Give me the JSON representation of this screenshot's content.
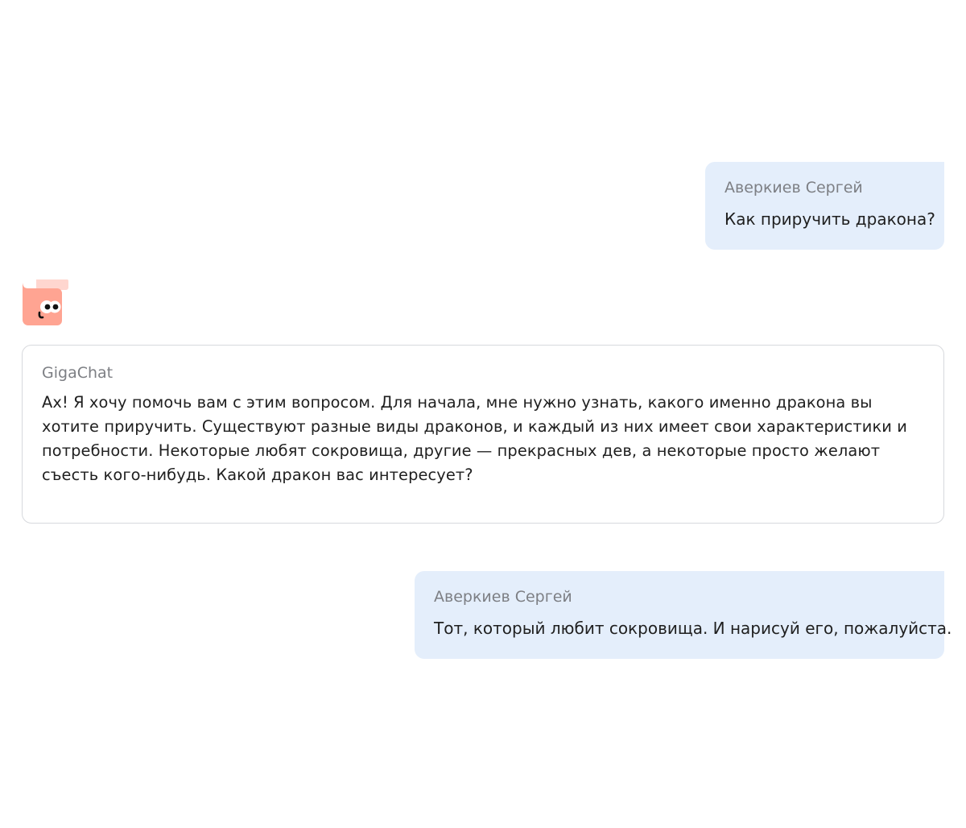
{
  "messages": [
    {
      "author": "Аверкиев Сергей",
      "text": "Как приручить дракона?"
    },
    {
      "author": "GigaChat",
      "avatar_icon": "gigachat-mascot-icon",
      "text": "Ах! Я хочу помочь вам с этим вопросом. Для начала, мне нужно узнать, какого именно дракона вы хотите приручить. Существуют разные виды драконов, и каждый из них имеет свои характеристики и потребности. Некоторые любят сокровища, другие — прекрасных дев, а некоторые просто желают съесть кого-нибудь. Какой дракон вас интересует?"
    },
    {
      "author": "Аверкиев Сергей",
      "text": "Тот, который любит сокровища. И нарисуй его, пожалуйста."
    }
  ],
  "colors": {
    "user_bubble": "#e4eefb",
    "bot_border": "#d7d9dd",
    "author_text": "#7d7f84",
    "mascot": "#ffa492",
    "mascot_light": "#ffd6cf"
  }
}
